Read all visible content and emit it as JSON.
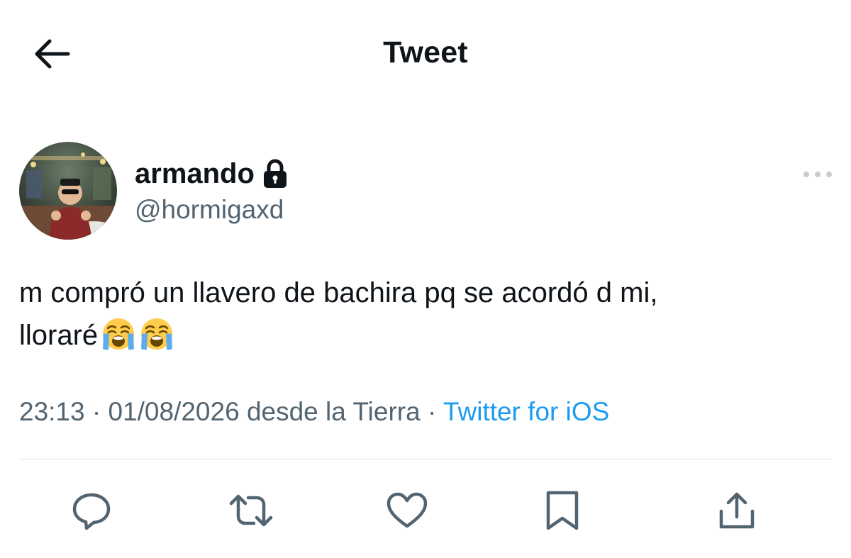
{
  "header": {
    "title": "Tweet",
    "back_icon": "arrow-left-icon"
  },
  "author": {
    "display_name": "armando",
    "handle": "@hormigaxd",
    "protected_icon": "lock-icon",
    "avatar": "avatar-photo"
  },
  "tweet": {
    "text_line1": "m compró un llavero de bachira pq se acordó d mi,",
    "text_line2": "lloraré",
    "emojis": [
      "loudly-crying-face-emoji",
      "loudly-crying-face-emoji"
    ]
  },
  "meta": {
    "time": "23:13",
    "separator": " · ",
    "date": "01/08/2026",
    "location": "desde la Tierra",
    "source": "Twitter for iOS"
  },
  "actions": [
    {
      "name": "reply",
      "icon": "reply-icon"
    },
    {
      "name": "retweet",
      "icon": "retweet-icon"
    },
    {
      "name": "like",
      "icon": "heart-icon"
    },
    {
      "name": "bookmark",
      "icon": "bookmark-icon"
    },
    {
      "name": "share",
      "icon": "share-icon"
    }
  ],
  "colors": {
    "text": "#0f1419",
    "secondary": "#536471",
    "link": "#1d9bf0",
    "divider": "#dbe1e5"
  }
}
